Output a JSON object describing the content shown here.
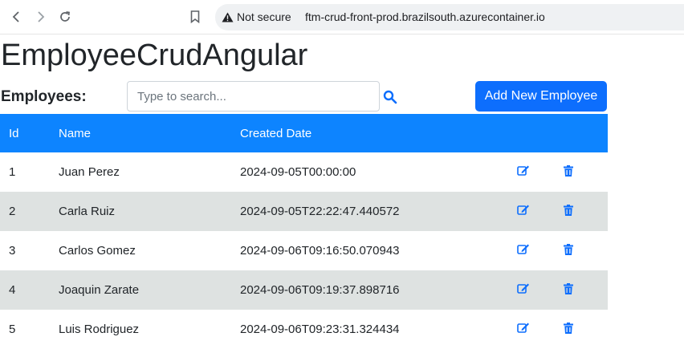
{
  "browser": {
    "security_label": "Not secure",
    "url": "ftm-crud-front-prod.brazilsouth.azurecontainer.io"
  },
  "app": {
    "title": "EmployeeCrudAngular",
    "employees_label": "Employees:",
    "search": {
      "placeholder": "Type to search...",
      "value": ""
    },
    "add_button_label": "Add New Employee",
    "accent_color": "#0d6efd",
    "header_color": "#0d84ff"
  },
  "table": {
    "columns": {
      "id": "Id",
      "name": "Name",
      "created": "Created Date"
    },
    "rows": [
      {
        "id": "1",
        "name": "Juan Perez",
        "created": "2024-09-05T00:00:00"
      },
      {
        "id": "2",
        "name": "Carla Ruiz",
        "created": "2024-09-05T22:22:47.440572"
      },
      {
        "id": "3",
        "name": "Carlos Gomez",
        "created": "2024-09-06T09:16:50.070943"
      },
      {
        "id": "4",
        "name": "Joaquin Zarate",
        "created": "2024-09-06T09:19:37.898716"
      },
      {
        "id": "5",
        "name": "Luis Rodriguez",
        "created": "2024-09-06T09:23:31.324434"
      }
    ]
  },
  "icons": {
    "back": "arrow-left-icon",
    "forward": "arrow-right-icon",
    "reload": "reload-icon",
    "bookmark": "bookmark-icon",
    "security": "warning-icon",
    "search": "search-icon",
    "edit": "edit-icon",
    "delete": "trash-icon"
  }
}
